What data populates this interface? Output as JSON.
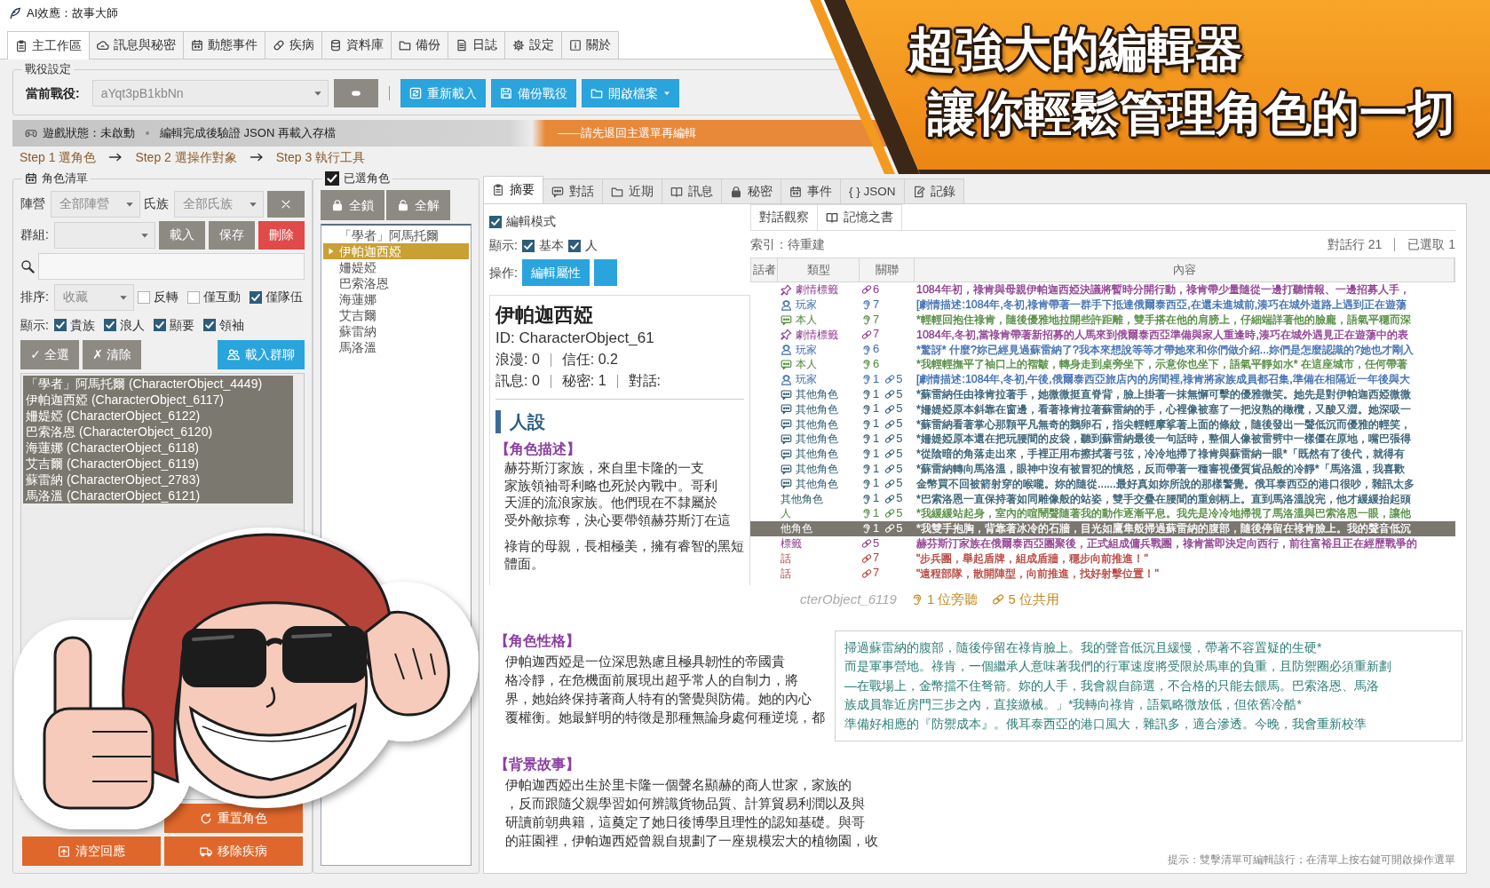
{
  "window": {
    "title": "AI效應：故事大師"
  },
  "main_tabs": [
    {
      "label": "主工作區",
      "selected": true
    },
    {
      "label": "訊息與秘密",
      "selected": false
    },
    {
      "label": "動態事件",
      "selected": false
    },
    {
      "label": "疾病",
      "selected": false
    },
    {
      "label": "資料庫",
      "selected": false
    },
    {
      "label": "備份",
      "selected": false
    },
    {
      "label": "日誌",
      "selected": false
    },
    {
      "label": "設定",
      "selected": false
    },
    {
      "label": "關於",
      "selected": false
    }
  ],
  "campaign": {
    "legend": "戰役設定",
    "label": "當前戰役:",
    "value": "aYqt3pB1kbNn",
    "buttons": [
      {
        "label": "重新載入",
        "kind": "action"
      },
      {
        "label": "備份戰役",
        "kind": "action"
      },
      {
        "label": "開啟檔案",
        "kind": "menu"
      }
    ]
  },
  "status_bar": {
    "game_state": "遊戲狀態：未啟動",
    "hint": "編輯完成後驗證 JSON 再載入存檔",
    "warning": "——請先退回主選單再編輯"
  },
  "steps": [
    "Step 1 選角色",
    "Step 2 選操作對象",
    "Step 3 執行工具"
  ],
  "character_list": {
    "legend": "角色清單",
    "faction_label": "陣營",
    "faction_value": "全部陣營",
    "clan_label": "氏族",
    "clan_value": "全部氏族",
    "group_label": "群組:",
    "group_buttons": [
      {
        "label": "載入",
        "kind": "normal"
      },
      {
        "label": "保存",
        "kind": "normal"
      },
      {
        "label": "刪除",
        "kind": "danger"
      }
    ],
    "sort_label": "排序:",
    "sort_value": "收藏",
    "sort_options": [
      {
        "label": "反轉",
        "checked": false
      },
      {
        "label": "僅互動",
        "checked": false
      },
      {
        "label": "僅隊伍",
        "checked": true
      }
    ],
    "show_label": "顯示:",
    "show_options": [
      {
        "label": "貴族",
        "checked": true
      },
      {
        "label": "浪人",
        "checked": true
      },
      {
        "label": "顯要",
        "checked": true
      },
      {
        "label": "領袖",
        "checked": true
      }
    ],
    "select_all": "✓ 全選",
    "clear": "✗ 清除",
    "load_chat": "載入群聊",
    "items": [
      {
        "label": "「學者」阿馬托爾 (CharacterObject_4449)",
        "selected": true
      },
      {
        "label": "伊帕迦西婭 (CharacterObject_6117)",
        "selected": true
      },
      {
        "label": "姍媞婭 (CharacterObject_6122)",
        "selected": true
      },
      {
        "label": "巴索洛恩 (CharacterObject_6120)",
        "selected": true
      },
      {
        "label": "海蓮娜 (CharacterObject_6118)",
        "selected": true
      },
      {
        "label": "艾吉爾 (CharacterObject_6119)",
        "selected": true
      },
      {
        "label": "蘇雷納 (CharacterObject_2783)",
        "selected": true
      },
      {
        "label": "馬洛溫 (CharacterObject_6121)",
        "selected": true
      }
    ],
    "actions": [
      "重置角色",
      "清空回應",
      "移除疾病"
    ]
  },
  "selected_characters": {
    "legend": "已選角色",
    "checked": true,
    "lock_all": "全鎖",
    "unlock_all": "全解",
    "items": [
      {
        "label": "「學者」阿馬托爾",
        "selected": false
      },
      {
        "label": "伊帕迦西婭",
        "selected": true
      },
      {
        "label": "姍媞婭",
        "selected": false
      },
      {
        "label": "巴索洛恩",
        "selected": false
      },
      {
        "label": "海蓮娜",
        "selected": false
      },
      {
        "label": "艾吉爾",
        "selected": false
      },
      {
        "label": "蘇雷納",
        "selected": false
      },
      {
        "label": "馬洛溫",
        "selected": false
      }
    ]
  },
  "detail_tabs": [
    {
      "label": "摘要",
      "selected": true
    },
    {
      "label": "對話",
      "selected": false
    },
    {
      "label": "近期",
      "selected": false
    },
    {
      "label": "訊息",
      "selected": false
    },
    {
      "label": "秘密",
      "selected": false
    },
    {
      "label": "事件",
      "selected": false
    },
    {
      "label": "{ } JSON",
      "selected": false
    },
    {
      "label": "記錄",
      "selected": false
    }
  ],
  "summary": {
    "edit_mode": {
      "label": "編輯模式",
      "checked": true
    },
    "show_label": "顯示:",
    "show_options": [
      {
        "label": "基本",
        "checked": true
      },
      {
        "label": "人",
        "checked": true
      }
    ],
    "action_label": "操作:",
    "action_button": "編輯屬性",
    "name": "伊帕迦西婭",
    "id": "ID: CharacterObject_61",
    "stats": [
      [
        "浪漫: 0",
        "信任: 0.2"
      ],
      [
        "訊息: 0",
        "秘密: 1",
        "對話:"
      ]
    ],
    "heading": "人設",
    "sections": [
      {
        "title": "【角色描述】",
        "paragraphs": [
          [
            "赫芬斯汀家族，來自里卡隆的一支",
            "家族領袖哥利略也死於內戰中。哥利",
            "天涯的流浪家族。他們現在不隸屬於",
            "受外敵掠奪，決心要帶領赫芬斯汀在這"
          ],
          [
            "祿肯的母親，長相極美，擁有睿智的黑短",
            "體面。"
          ]
        ]
      },
      {
        "title": "【角色性格】",
        "paragraphs": [
          [
            "伊帕迦西婭是一位深思熟慮且極具韌性的帝國貴",
            "格冷靜，在危機面前展現出超乎常人的自制力，將",
            "界，她始終保持著商人特有的警覺與防備。她的內心",
            "覆權衡。她最鮮明的特徵是那種無論身處何種逆境，都"
          ]
        ]
      },
      {
        "title": "【背景故事】",
        "paragraphs": [
          [
            "伊帕迦西婭出生於里卡隆一個聲名顯赫的商人世家，家族的",
            "，反而跟隨父親學習如何辨識貨物品質、計算貿易利潤以及與",
            "研讀前朝典籍，這奠定了她日後博學且理性的認知基礎。與哥",
            "的莊園裡，伊帕迦西婭曾親自規劃了一座規模宏大的植物園，收"
          ]
        ]
      }
    ]
  },
  "dialogue": {
    "sub_tabs": [
      {
        "label": "對話觀察",
        "selected": false
      },
      {
        "label": "記憶之書",
        "selected": false
      }
    ],
    "index_status": "索引：待重建",
    "line_count": "對話行 21",
    "selected_count": "已選取 1",
    "columns": [
      "話者",
      "類型",
      "關聯",
      "內容"
    ],
    "rows": [
      {
        "kind": "plot",
        "type": "劇情標籤",
        "color": "#8e3b8f",
        "links": [
          {
            "kind": "shared",
            "count": "6"
          }
        ],
        "content": "1084年初，祿肯與母親伊帕迦西婭決議將暫時分開行動，祿肯帶少量隨從一邊打聽情報、一邊招募人手，",
        "selected": false
      },
      {
        "kind": "player",
        "type": "玩家",
        "color": "#3d6db0",
        "links": [
          {
            "kind": "listen",
            "count": "7"
          }
        ],
        "content": "[劇情描述:1084年,冬初,祿肯帶著一群手下抵達俄爾泰西亞,在還未進城前,湊巧在城外道路上遇到正在遊蕩",
        "selected": false
      },
      {
        "kind": "chat",
        "type": "本人",
        "color": "#4f8a3c",
        "links": [
          {
            "kind": "listen",
            "count": "7"
          }
        ],
        "content": "*輕輕回抱住祿肯，隨後優雅地拉開些許距離，雙手搭在他的肩膀上，仔細端詳著他的臉龐，語氣平穩而深",
        "selected": false
      },
      {
        "kind": "plot",
        "type": "劇情標籤",
        "color": "#8e3b8f",
        "links": [
          {
            "kind": "shared",
            "count": "7"
          }
        ],
        "content": "1084年,冬初,當祿肯帶著新招募的人馬來到俄爾泰西亞準備與家人重逢時,湊巧在城外遇見正在遊蕩中的表",
        "selected": false
      },
      {
        "kind": "player",
        "type": "玩家",
        "color": "#3d6db0",
        "links": [
          {
            "kind": "listen",
            "count": "6"
          }
        ],
        "content": "*驚訝* 什麼?妳已經見過蘇雷納了?我本來想說等等才帶她來和你們做介紹...妳們是怎麼認識的?她也才剛入",
        "selected": false
      },
      {
        "kind": "chat",
        "type": "本人",
        "color": "#4f8a3c",
        "links": [
          {
            "kind": "listen",
            "count": "6"
          }
        ],
        "content": "*我輕輕撫平了袖口上的褶皺，轉身走到桌旁坐下，示意你也坐下，語氣平靜如水* 在這座城市，任何帶著",
        "selected": false
      },
      {
        "kind": "player",
        "type": "玩家",
        "color": "#3d6db0",
        "links": [
          {
            "kind": "listen",
            "count": "1"
          },
          {
            "kind": "shared",
            "count": "5"
          }
        ],
        "content": "[劇情描述:1084年,冬初,午後,俄爾泰西亞旅店內的房間裡,祿肯將家族成員都召集,準備在相隔近一年後與大",
        "selected": false
      },
      {
        "kind": "chat",
        "type": "其他角色",
        "color": "#2f5b70",
        "links": [
          {
            "kind": "listen",
            "count": "1"
          },
          {
            "kind": "shared",
            "count": "5"
          }
        ],
        "content": "*蘇雷納任由祿肯拉著手，她微微挺直脊背，臉上掛著一抹無懈可擊的優雅微笑。她先是對伊帕迦西婭微微",
        "selected": false
      },
      {
        "kind": "chat",
        "type": "其他角色",
        "color": "#2f5b70",
        "links": [
          {
            "kind": "listen",
            "count": "1"
          },
          {
            "kind": "shared",
            "count": "5"
          }
        ],
        "content": "*姍媞婭原本斜靠在窗邊，看著祿肯拉著蘇雷納的手，心裡像被塞了一把沒熟的橄欖，又酸又澀。她深吸一",
        "selected": false
      },
      {
        "kind": "chat",
        "type": "其他角色",
        "color": "#2f5b70",
        "links": [
          {
            "kind": "listen",
            "count": "1"
          },
          {
            "kind": "shared",
            "count": "5"
          }
        ],
        "content": "*蘇雷納看著掌心那顆平凡無奇的鵝卵石，指尖輕輕摩挲著上面的條紋，隨後發出一聲低沉而優雅的輕笑，",
        "selected": false
      },
      {
        "kind": "chat",
        "type": "其他角色",
        "color": "#2f5b70",
        "links": [
          {
            "kind": "listen",
            "count": "1"
          },
          {
            "kind": "shared",
            "count": "5"
          }
        ],
        "content": "*姍媞婭原本還在把玩腰間的皮袋，聽到蘇雷納最後一句話時，整個人像被雷劈中一樣僵在原地，嘴巴張得",
        "selected": false
      },
      {
        "kind": "chat",
        "type": "其他角色",
        "color": "#2f5b70",
        "links": [
          {
            "kind": "listen",
            "count": "1"
          },
          {
            "kind": "shared",
            "count": "5"
          }
        ],
        "content": "*從陰暗的角落走出來，手裡正用布擦拭著弓弦，冷冷地掃了祿肯與蘇雷納一眼*「既然有了後代，就得有",
        "selected": false
      },
      {
        "kind": "chat",
        "type": "其他角色",
        "color": "#2f5b70",
        "links": [
          {
            "kind": "listen",
            "count": "1"
          },
          {
            "kind": "shared",
            "count": "5"
          }
        ],
        "content": "*蘇雷納轉向馬洛溫，眼神中沒有被冒犯的憤怒，反而帶著一種審視優質貨品般的冷靜*「馬洛溫，我喜歡",
        "selected": false
      },
      {
        "kind": "chat",
        "type": "其他角色",
        "color": "#2f5b70",
        "links": [
          {
            "kind": "listen",
            "count": "1"
          },
          {
            "kind": "shared",
            "count": "5"
          }
        ],
        "content": "金幣買不回被箭射穿的喉嚨。妳的隨從......最好真如妳所說的那樣警覺。俄耳泰西亞的港口很吵，雜訊太多",
        "selected": false
      },
      {
        "type": "其他角色",
        "color": "#2f5b70",
        "links": [
          {
            "kind": "listen",
            "count": "1"
          },
          {
            "kind": "shared",
            "count": "5"
          }
        ],
        "content": "*巴索洛恩一直保持著如同雕像般的站姿，雙手交疊在腰間的重劍柄上。直到馬洛溫說完，他才緩緩抬起頭",
        "selected": false
      },
      {
        "type": "人",
        "color": "#4f8a3c",
        "links": [
          {
            "kind": "listen",
            "count": "1"
          },
          {
            "kind": "shared",
            "count": "5"
          }
        ],
        "content": "*我緩緩站起身，室內的喧鬧聲隨著我的動作逐漸平息。我先是冷冷地掃視了馬洛溫與巴索洛恩一眼，讓他",
        "selected": false
      },
      {
        "type": "他角色",
        "links": [
          {
            "kind": "listen",
            "count": "1"
          },
          {
            "kind": "shared",
            "count": "5"
          }
        ],
        "content": "*我雙手抱胸，背靠著冰冷的石牆，目光如鷹隼般掃過蘇雷納的腹部，隨後停留在祿肯臉上。我的聲音低沉",
        "selected": true
      },
      {
        "type": "標籤",
        "color": "#8e3b8f",
        "links": [
          {
            "kind": "shared",
            "count": "5"
          }
        ],
        "content": "赫芬斯汀家族在俄爾泰西亞團聚後，正式組成傭兵戰團，祿肯當即決定向西行，前往富裕且正在經歷戰爭的",
        "selected": false
      },
      {
        "type": "話",
        "color": "#b5413a",
        "links": [
          {
            "kind": "shared",
            "count": "7"
          }
        ],
        "content": "\"步兵團，舉起盾牌，組成盾牆，穩步向前推進！\"",
        "selected": false
      },
      {
        "type": "話",
        "color": "#b5413a",
        "links": [
          {
            "kind": "shared",
            "count": "7"
          }
        ],
        "content": "\"遠程部隊，散開陣型，向前推進，找好射擊位置！\"",
        "selected": false
      }
    ],
    "footer": {
      "speaker": "cterObject_6119",
      "listeners": "1 位旁聽",
      "shared": "5 位共用"
    },
    "preview": [
      "掃過蘇雷納的腹部，隨後停留在祿肯臉上。我的聲音低沉且緩慢，帶著不容置疑的生硬*",
      "而是軍事營地。祿肯，一個繼承人意味著我們的行軍速度將受限於馬車的負重，且防禦圈必須重新劃",
      "—在戰場上，金幣擋不住弩箭。妳的人手，我會親自篩選，不合格的只能去餵馬。巴索洛恩、馬洛",
      "族成員靠近房門三步之內，直接繳械。」*我轉向祿肯，語氣略微放低，但依舊冷酷*",
      "準備好相應的『防禦成本』。俄耳泰西亞的港口風大，雜訊多，適合滲透。今晚，我會重新校準"
    ],
    "hint": "提示：雙擊清單可編輯該行；在清單上按右鍵可開啟操作選單"
  },
  "banner": {
    "headline": "超強大的編輯器",
    "subheadline": "讓你輕鬆管理角色的一切"
  }
}
